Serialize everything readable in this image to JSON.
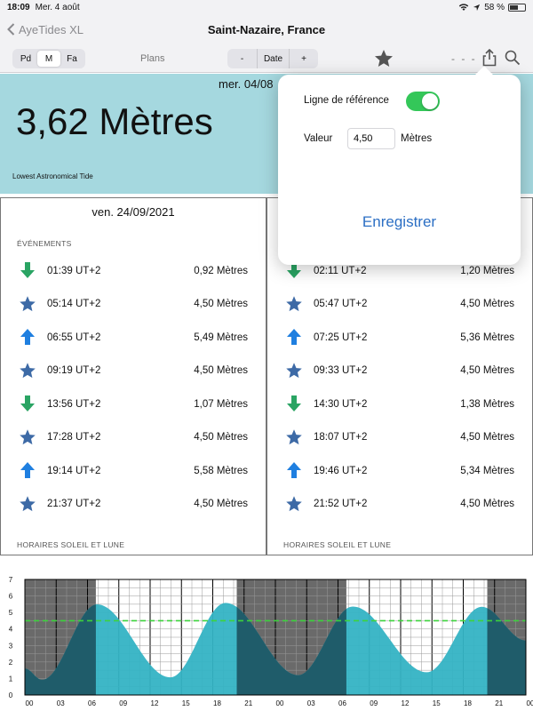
{
  "status": {
    "time": "18:09",
    "date": "Mer. 4 août",
    "battery": "58 %",
    "battery_level": 0.58
  },
  "nav": {
    "back_label": "AyeTides XL",
    "title": "Saint-Nazaire, France"
  },
  "toolbar": {
    "segments": [
      "Pd",
      "M",
      "Fa"
    ],
    "selected_segment": "M",
    "plans_label": "Plans",
    "date_minus": "-",
    "date_label": "Date",
    "date_plus": "+",
    "dashes": "- - -"
  },
  "hero": {
    "date": "mer. 04/08",
    "height": "3,62 Mètres",
    "reference": "Lowest Astronomical Tide",
    "color": "#a5d8df"
  },
  "left_column": {
    "day": "ven. 24/09/2021",
    "events_title": "ÉVÉNEMENTS",
    "sun_moon_title": "HORAIRES SOLEIL ET LUNE",
    "events": [
      {
        "type": "low",
        "time": "01:39 UT+2",
        "height": "0,92 Mètres"
      },
      {
        "type": "star",
        "time": "05:14 UT+2",
        "height": "4,50 Mètres"
      },
      {
        "type": "high",
        "time": "06:55 UT+2",
        "height": "5,49 Mètres"
      },
      {
        "type": "star",
        "time": "09:19 UT+2",
        "height": "4,50 Mètres"
      },
      {
        "type": "low",
        "time": "13:56 UT+2",
        "height": "1,07 Mètres"
      },
      {
        "type": "star",
        "time": "17:28 UT+2",
        "height": "4,50 Mètres"
      },
      {
        "type": "high",
        "time": "19:14 UT+2",
        "height": "5,58 Mètres"
      },
      {
        "type": "star",
        "time": "21:37 UT+2",
        "height": "4,50 Mètres"
      }
    ]
  },
  "right_column": {
    "sun_moon_title": "HORAIRES SOLEIL ET LUNE",
    "events": [
      {
        "type": "low",
        "time": "02:11 UT+2",
        "height": "1,20 Mètres"
      },
      {
        "type": "star",
        "time": "05:47 UT+2",
        "height": "4,50 Mètres"
      },
      {
        "type": "high",
        "time": "07:25 UT+2",
        "height": "5,36 Mètres"
      },
      {
        "type": "star",
        "time": "09:33 UT+2",
        "height": "4,50 Mètres"
      },
      {
        "type": "low",
        "time": "14:30 UT+2",
        "height": "1,38 Mètres"
      },
      {
        "type": "star",
        "time": "18:07 UT+2",
        "height": "4,50 Mètres"
      },
      {
        "type": "high",
        "time": "19:46 UT+2",
        "height": "5,34 Mètres"
      },
      {
        "type": "star",
        "time": "21:52 UT+2",
        "height": "4,50 Mètres"
      }
    ]
  },
  "popover": {
    "reference_line_label": "Ligne de référence",
    "reference_line_enabled": true,
    "value_label": "Valeur",
    "value": "4,50",
    "unit": "Mètres",
    "save_label": "Enregistrer"
  },
  "colors": {
    "accent_blue": "#2c6fc4",
    "toggle_green": "#34c759",
    "low_arrow": "#2aa463",
    "high_arrow": "#1f7fe0",
    "star": "#3d6aa6",
    "tide_light": "#34b3c4",
    "tide_dark": "#1f5c6a",
    "reference_line": "#3cd33c"
  },
  "chart_data": {
    "type": "area",
    "y_ticks": [
      "0",
      "1",
      "2",
      "3",
      "4",
      "5",
      "6",
      "7"
    ],
    "x_ticks": [
      "00",
      "03",
      "06",
      "09",
      "12",
      "15",
      "18",
      "21",
      "00",
      "03",
      "06",
      "09",
      "12",
      "15",
      "18",
      "21",
      "00"
    ],
    "ylim": [
      0,
      7
    ],
    "xlim": [
      0,
      48
    ],
    "reference_line": 4.5,
    "series": [
      {
        "points": [
          [
            0,
            1.6
          ],
          [
            1.65,
            0.92
          ],
          [
            6.92,
            5.49
          ],
          [
            13.93,
            1.07
          ],
          [
            19.23,
            5.58
          ],
          [
            26.18,
            1.2
          ],
          [
            31.42,
            5.36
          ],
          [
            38.5,
            1.38
          ],
          [
            43.77,
            5.34
          ],
          [
            48,
            3.3
          ]
        ]
      }
    ],
    "night_ranges": [
      [
        0,
        6.8
      ],
      [
        20.3,
        30.8
      ],
      [
        44.3,
        48
      ]
    ],
    "grid": true
  }
}
